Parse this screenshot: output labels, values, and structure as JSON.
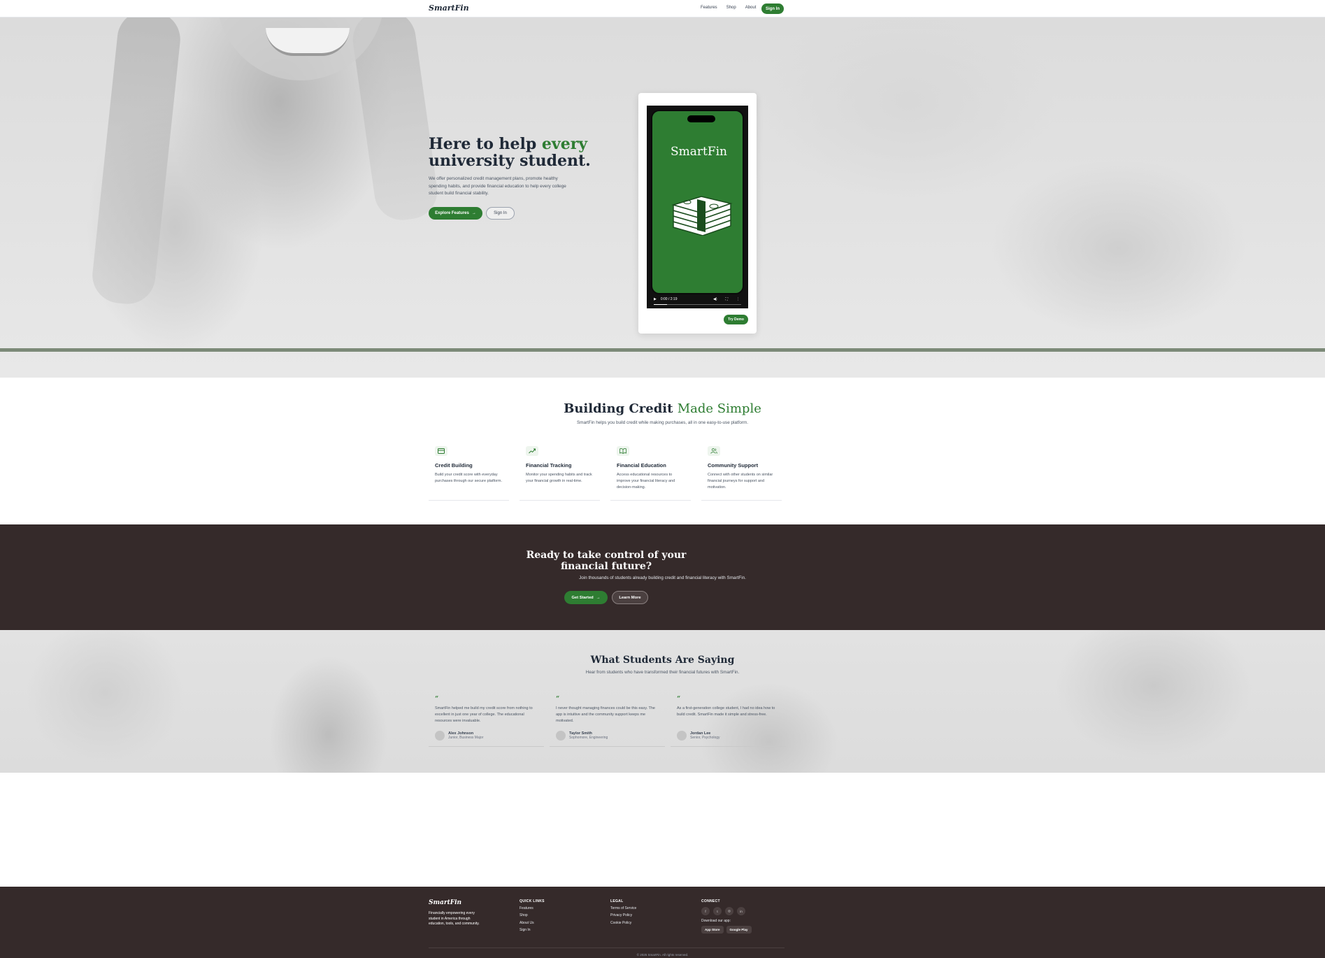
{
  "nav": {
    "logo": "SmartFin",
    "links": [
      "Features",
      "Shop",
      "About"
    ],
    "signin": "Sign In"
  },
  "hero": {
    "title_pre": "Here to help ",
    "title_accent": "every",
    "title_post": "university student.",
    "description": "We offer personalized credit management plans, promote healthy spending habits, and provide financial education to help every college student build financial stability.",
    "explore_label": "Explore Features",
    "signin_label": "Sign In",
    "video": {
      "brand": "SmartFin",
      "time": "0:00 / 2:19",
      "progress": 0.15
    },
    "try_demo": "Try Demo"
  },
  "features": {
    "title_pre": "Building Credit ",
    "title_accent": "Made Simple",
    "subtitle": "SmartFin helps you build credit while making purchases, all in one easy-to-use platform.",
    "cards": [
      {
        "icon": "credit-card-icon",
        "title": "Credit Building",
        "desc": "Build your credit score with everyday purchases through our secure platform."
      },
      {
        "icon": "trending-up-icon",
        "title": "Financial Tracking",
        "desc": "Monitor your spending habits and track your financial growth in real-time."
      },
      {
        "icon": "book-open-icon",
        "title": "Financial Education",
        "desc": "Access educational resources to improve your financial literacy and decision-making."
      },
      {
        "icon": "users-icon",
        "title": "Community Support",
        "desc": "Connect with other students on similar financial journeys for support and motivation."
      }
    ]
  },
  "cta": {
    "title": "Ready to take control of your financial future?",
    "subtitle": "Join thousands of students already building credit and financial literacy with SmartFin.",
    "get_started": "Get Started",
    "learn_more": "Learn More"
  },
  "testimonials": {
    "title": "What Students Are Saying",
    "subtitle": "Hear from students who have transformed their financial futures with SmartFin.",
    "items": [
      {
        "quote": "SmartFin helped me build my credit score from nothing to excellent in just one year of college. The educational resources were invaluable.",
        "name": "Alex Johnson",
        "role": "Junior, Business Major"
      },
      {
        "quote": "I never thought managing finances could be this easy. The app is intuitive and the community support keeps me motivated.",
        "name": "Taylor Smith",
        "role": "Sophomore, Engineering"
      },
      {
        "quote": "As a first-generation college student, I had no idea how to build credit. SmartFin made it simple and stress-free.",
        "name": "Jordan Lee",
        "role": "Senior, Psychology"
      }
    ]
  },
  "footer": {
    "logo": "SmartFin",
    "tagline": "Financially empowering every student in America through education, tools, and community.",
    "quick_links_title": "QUICK LINKS",
    "quick_links": [
      "Features",
      "Shop",
      "About Us",
      "Sign In"
    ],
    "legal_title": "LEGAL",
    "legal": [
      "Terms of Service",
      "Privacy Policy",
      "Cookie Policy"
    ],
    "connect_title": "CONNECT",
    "social": [
      "f",
      "t",
      "◎",
      "in"
    ],
    "download": "Download our app:",
    "app_store": "App Store",
    "google_play": "Google Play",
    "copyright": "© 2025 SmartFin. All rights reserved."
  },
  "colors": {
    "accent": "#2e7d32",
    "dark": "#352a2a"
  }
}
